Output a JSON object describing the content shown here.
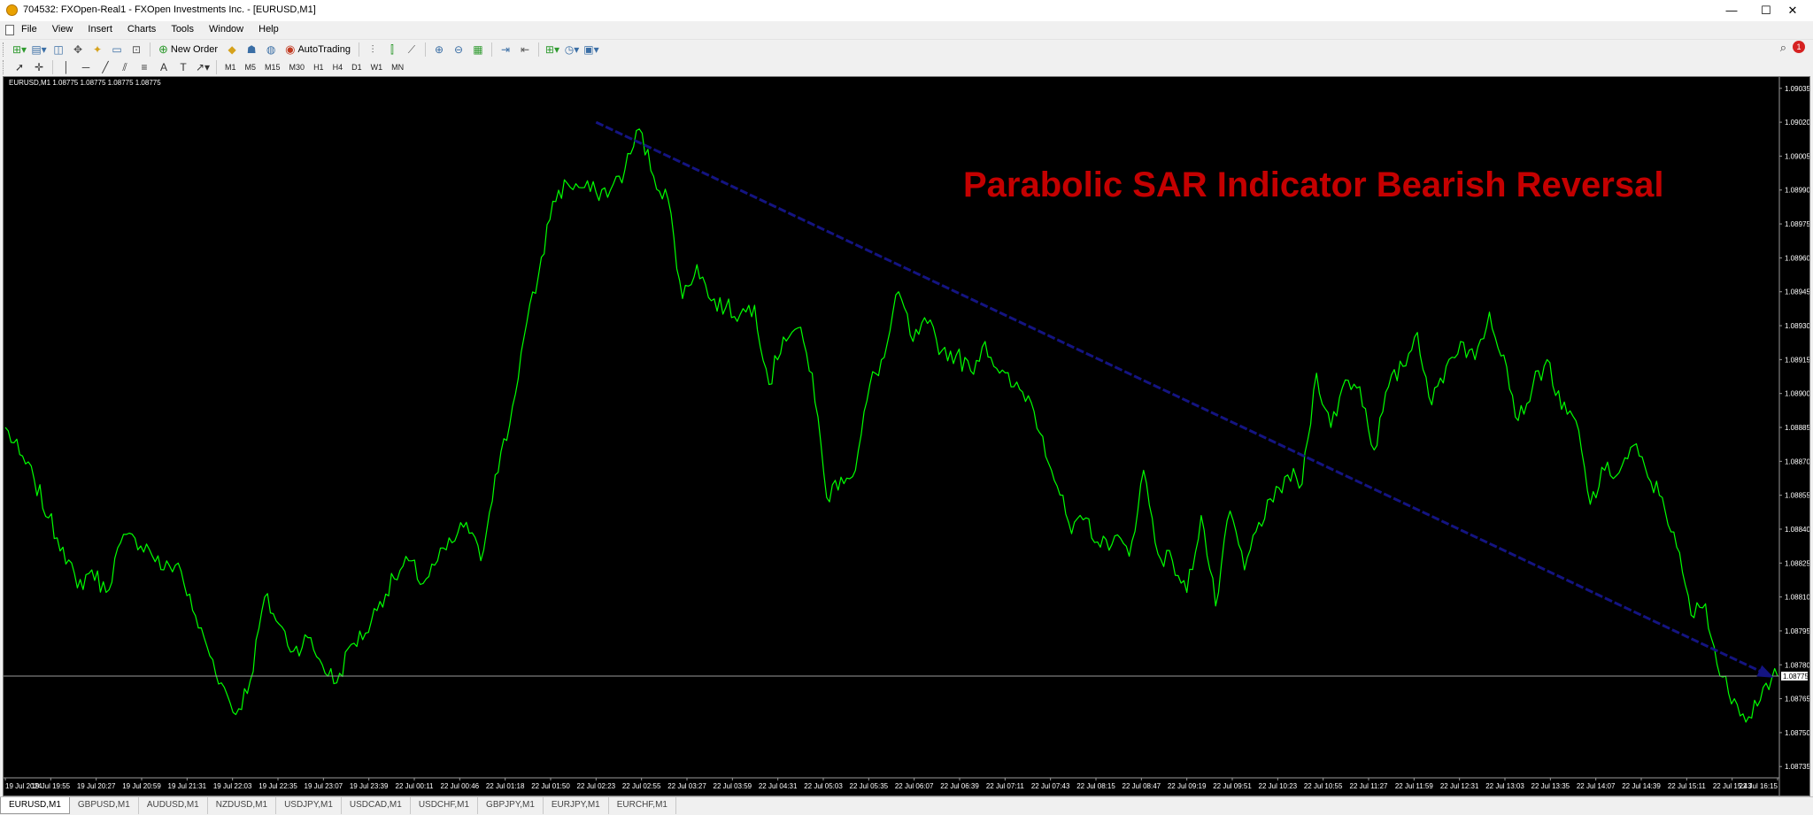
{
  "window": {
    "title": "704532: FXOpen-Real1 - FXOpen Investments Inc. - [EURUSD,M1]",
    "controls": {
      "minimize": "—",
      "maximize": "☐",
      "close": "✕"
    }
  },
  "menu": [
    "File",
    "View",
    "Insert",
    "Charts",
    "Tools",
    "Window",
    "Help"
  ],
  "toolbar": {
    "new_order": "New Order",
    "autotrading": "AutoTrading",
    "notification_count": "1"
  },
  "timeframes": [
    "M1",
    "M5",
    "M15",
    "M30",
    "H1",
    "H4",
    "D1",
    "W1",
    "MN"
  ],
  "chart": {
    "info_label": "EURUSD,M1  1.08775 1.08775 1.08775 1.08775",
    "annotation": "Parabolic SAR Indicator Bearish Reversal",
    "annotation_color": "#c40000",
    "line_color": "#00ff00",
    "trendline_color": "#141482",
    "current_price": "1.08775"
  },
  "tabs": [
    "EURUSD,M1",
    "GBPUSD,M1",
    "AUDUSD,M1",
    "NZDUSD,M1",
    "USDJPY,M1",
    "USDCAD,M1",
    "USDCHF,M1",
    "GBPJPY,M1",
    "EURJPY,M1",
    "EURCHF,M1"
  ],
  "chart_data": {
    "type": "line",
    "symbol": "EURUSD",
    "timeframe": "M1",
    "ylim": [
      1.0873,
      1.0904
    ],
    "y_ticks": [
      "1.09035",
      "1.09020",
      "1.09005",
      "1.08990",
      "1.08975",
      "1.08960",
      "1.08945",
      "1.08930",
      "1.08915",
      "1.08900",
      "1.08885",
      "1.08870",
      "1.08855",
      "1.08840",
      "1.08825",
      "1.08810",
      "1.08795",
      "1.08780",
      "1.08765",
      "1.08750",
      "1.08735"
    ],
    "x_ticks": [
      "19 Jul 2024",
      "19 Jul 19:55",
      "19 Jul 20:27",
      "19 Jul 20:59",
      "19 Jul 21:31",
      "19 Jul 22:03",
      "19 Jul 22:35",
      "19 Jul 23:07",
      "19 Jul 23:39",
      "22 Jul 00:11",
      "22 Jul 00:46",
      "22 Jul 01:18",
      "22 Jul 01:50",
      "22 Jul 02:23",
      "22 Jul 02:55",
      "22 Jul 03:27",
      "22 Jul 03:59",
      "22 Jul 04:31",
      "22 Jul 05:03",
      "22 Jul 05:35",
      "22 Jul 06:07",
      "22 Jul 06:39",
      "22 Jul 07:11",
      "22 Jul 07:43",
      "22 Jul 08:15",
      "22 Jul 08:47",
      "22 Jul 09:19",
      "22 Jul 09:51",
      "22 Jul 10:23",
      "22 Jul 10:55",
      "22 Jul 11:27",
      "22 Jul 11:59",
      "22 Jul 12:31",
      "22 Jul 13:03",
      "22 Jul 13:35",
      "22 Jul 14:07",
      "22 Jul 14:39",
      "22 Jul 15:11",
      "22 Jul 15:43",
      "22 Jul 16:15"
    ],
    "series": [
      {
        "values": [
          1.08885,
          1.08873,
          1.08862,
          1.08845,
          1.08832,
          1.08814,
          1.08822,
          1.08812,
          1.08834,
          1.08836,
          1.08831,
          1.08822,
          1.08825,
          1.08804,
          1.08788,
          1.08772,
          1.08758,
          1.08773,
          1.0881,
          1.08798,
          1.08786,
          1.08792,
          1.0878,
          1.08772,
          1.08789,
          1.08794,
          1.08808,
          1.08818,
          1.08826,
          1.08816,
          1.08826,
          1.08834,
          1.08843,
          1.08826,
          1.08864,
          1.08886,
          1.08925,
          1.08952,
          1.08985,
          1.08993,
          1.08991,
          1.08989,
          1.0899,
          1.08999,
          1.09017,
          1.08996,
          1.08986,
          1.08942,
          1.08957,
          1.08941,
          1.08938,
          1.08935,
          1.08939,
          1.08904,
          1.08925,
          1.08929,
          1.08909,
          1.08854,
          1.08863,
          1.08866,
          1.08904,
          1.08916,
          1.08945,
          1.08923,
          1.08931,
          1.08919,
          1.08917,
          1.0891,
          1.08923,
          1.08909,
          1.08903,
          1.08899,
          1.08881,
          1.08859,
          1.08838,
          1.08845,
          1.08832,
          1.08837,
          1.08828,
          1.08866,
          1.08829,
          1.08826,
          1.08812,
          1.08846,
          1.08806,
          1.08848,
          1.08822,
          1.08843,
          1.08852,
          1.08864,
          1.0886,
          1.08909,
          1.08885,
          1.08906,
          1.08903,
          1.08875,
          1.08903,
          1.08912,
          1.08927,
          1.08895,
          1.08912,
          1.08923,
          1.08915,
          1.08936,
          1.08917,
          1.08888,
          1.08903,
          1.08915,
          1.08893,
          1.08888,
          1.08851,
          1.08866,
          1.08865,
          1.08877,
          1.08863,
          1.08854,
          1.08832,
          1.08802,
          1.08807,
          1.08775,
          1.08765,
          1.08757,
          1.0877,
          1.08775
        ]
      }
    ],
    "trendline": {
      "from": [
        "22 Jul 02:23",
        1.0902
      ],
      "to": [
        "22 Jul 16:15",
        1.08775
      ]
    },
    "bid_line": 1.08775
  }
}
